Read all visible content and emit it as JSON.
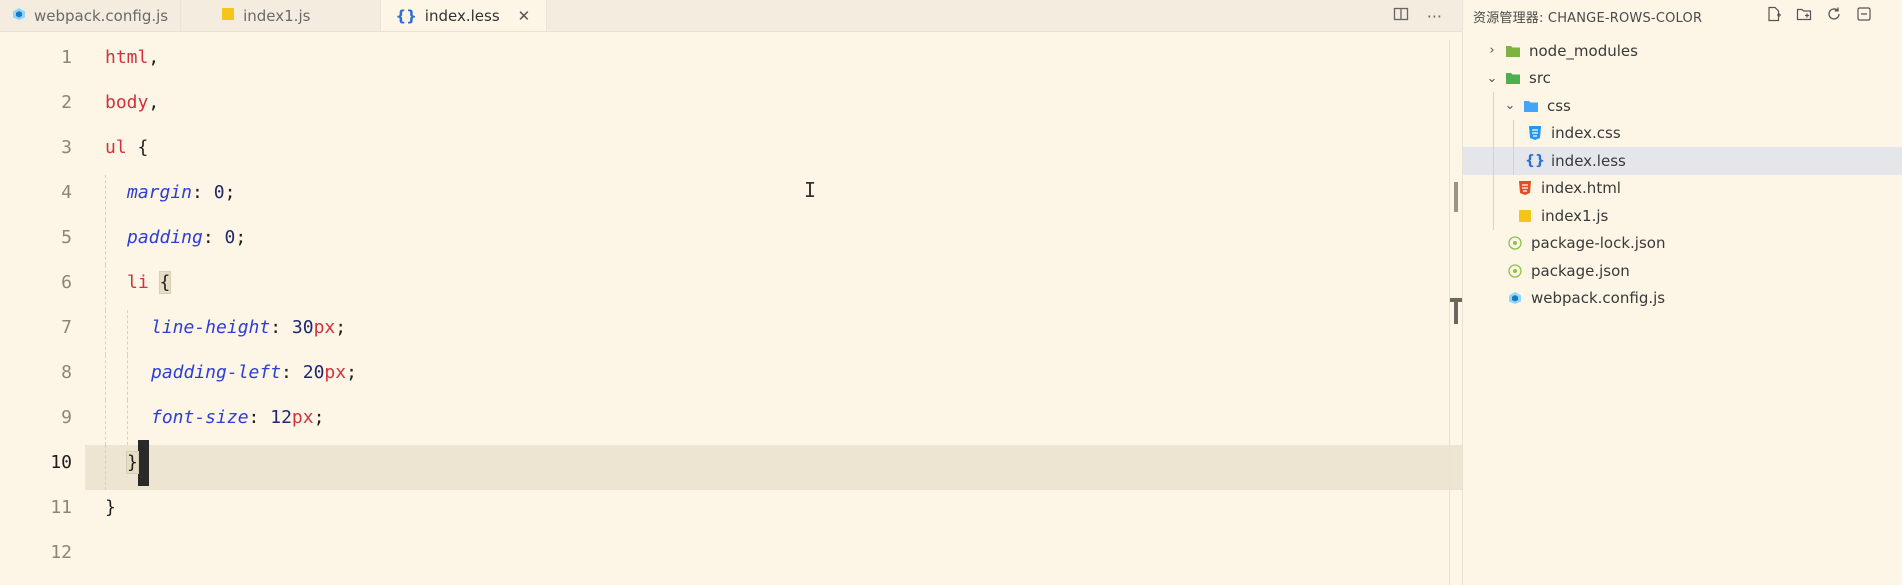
{
  "tabs": [
    {
      "label": "webpack.config.js",
      "icon": "webpack-icon",
      "active": false
    },
    {
      "label": "index1.js",
      "icon": "js-file-icon",
      "active": false
    },
    {
      "label": "index.less",
      "icon": "braces-icon",
      "active": true
    }
  ],
  "tab_close_glyph": "✕",
  "tab_actions": {
    "split": "split-editor-icon",
    "more": "···"
  },
  "line_numbers": [
    "1",
    "2",
    "3",
    "4",
    "5",
    "6",
    "7",
    "8",
    "9",
    "10",
    "11",
    "12"
  ],
  "code": {
    "l1": {
      "sel": "html",
      "punct": ","
    },
    "l2": {
      "sel": "body",
      "punct": ","
    },
    "l3": {
      "sel": "ul",
      "punct": " {"
    },
    "l4": {
      "prop": "margin",
      "colon": ": ",
      "num": "0",
      "end": ";"
    },
    "l5": {
      "prop": "padding",
      "colon": ": ",
      "num": "0",
      "end": ";"
    },
    "l6": {
      "sel": "li",
      "punct": "{"
    },
    "l7": {
      "prop": "line-height",
      "colon": ": ",
      "num": "30",
      "unit": "px",
      "end": ";"
    },
    "l8": {
      "prop": "padding-left",
      "colon": ": ",
      "num": "20",
      "unit": "px",
      "end": ";"
    },
    "l9": {
      "prop": "font-size",
      "colon": ": ",
      "num": "12",
      "unit": "px",
      "end": ";"
    },
    "l10": {
      "brace": "}"
    },
    "l11": {
      "brace": "}"
    }
  },
  "explorer": {
    "title": "资源管理器: CHANGE-ROWS-COLOR",
    "items": [
      {
        "label": "node_modules",
        "icon": "node-folder-icon",
        "chevron": "›",
        "selected": false
      },
      {
        "label": "src",
        "icon": "folder-src-icon",
        "chevron": "⌄",
        "selected": false
      },
      {
        "label": "css",
        "icon": "folder-css-icon",
        "chevron": "⌄",
        "selected": false
      },
      {
        "label": "index.css",
        "icon": "css-file-icon",
        "selected": false
      },
      {
        "label": "index.less",
        "icon": "less-file-icon",
        "selected": true
      },
      {
        "label": "index.html",
        "icon": "html-file-icon",
        "selected": false
      },
      {
        "label": "index1.js",
        "icon": "js-file-icon",
        "selected": false
      },
      {
        "label": "package-lock.json",
        "icon": "json-file-icon",
        "selected": false
      },
      {
        "label": "package.json",
        "icon": "json-file-icon",
        "selected": false
      },
      {
        "label": "webpack.config.js",
        "icon": "webpack-icon",
        "selected": false
      }
    ]
  },
  "colors": {
    "background": "#fdf5e6",
    "selector": "#d1323b",
    "property": "#2d3ed6",
    "selected_row": "#e4e6ea"
  }
}
